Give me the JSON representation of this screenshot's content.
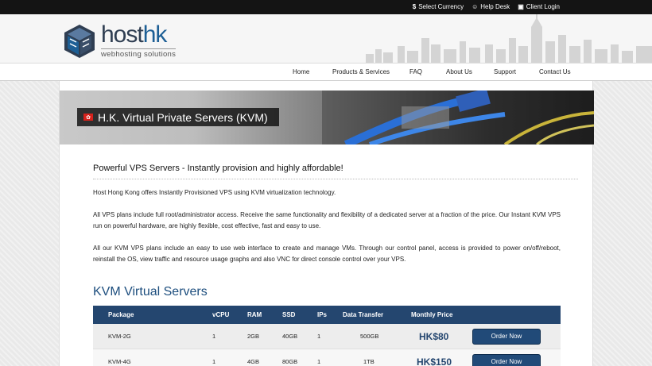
{
  "topbar": {
    "links": [
      {
        "icon": "dollar-icon",
        "glyph": "$",
        "label": "Select Currency"
      },
      {
        "icon": "user-icon",
        "glyph": "☺",
        "label": "Help Desk"
      },
      {
        "icon": "lock-icon",
        "glyph": "▣",
        "label": "Client Login"
      }
    ]
  },
  "logo": {
    "word_main": "host",
    "word_accent": "hk",
    "tagline": "webhosting solutions"
  },
  "nav": {
    "items": [
      "Home",
      "Products & Services",
      "FAQ",
      "About Us",
      "Support",
      "Contact Us"
    ]
  },
  "banner": {
    "title": "H.K. Virtual Private Servers (KVM)"
  },
  "intro": {
    "heading": "Powerful VPS Servers - Instantly provision and highly affordable!",
    "p1": "Host Hong Kong offers Instantly Provisioned VPS using KVM virtualization technology.",
    "p2": "All VPS plans include full root/administrator access. Receive the same functionality and flexibility of a dedicated server at a fraction of the price. Our Instant KVM VPS run on powerful hardware, are highly flexible, cost effective, fast and easy to use.",
    "p3": "All our KVM VPS plans include an easy to use web interface to create and manage VMs. Through our control panel, access is provided to power on/off/reboot, reinstall the OS, view traffic and resource usage graphs and also VNC for direct console control over your VPS."
  },
  "plans": {
    "title": "KVM Virtual Servers",
    "headers": {
      "package": "Package",
      "vcpu": "vCPU",
      "ram": "RAM",
      "ssd": "SSD",
      "ips": "IPs",
      "transfer": "Data Transfer",
      "price": "Monthly Price"
    },
    "rows": [
      {
        "package": "KVM-2G",
        "vcpu": "1",
        "ram": "2GB",
        "ssd": "40GB",
        "ips": "1",
        "transfer": "500GB",
        "price": "HK$80",
        "button": "Order Now"
      },
      {
        "package": "KVM-4G",
        "vcpu": "1",
        "ram": "4GB",
        "ssd": "80GB",
        "ips": "1",
        "transfer": "1TB",
        "price": "HK$150",
        "button": "Order Now"
      }
    ]
  },
  "colors": {
    "primary": "#24466f",
    "topbar": "#141414",
    "flag_red": "#d6221c"
  }
}
